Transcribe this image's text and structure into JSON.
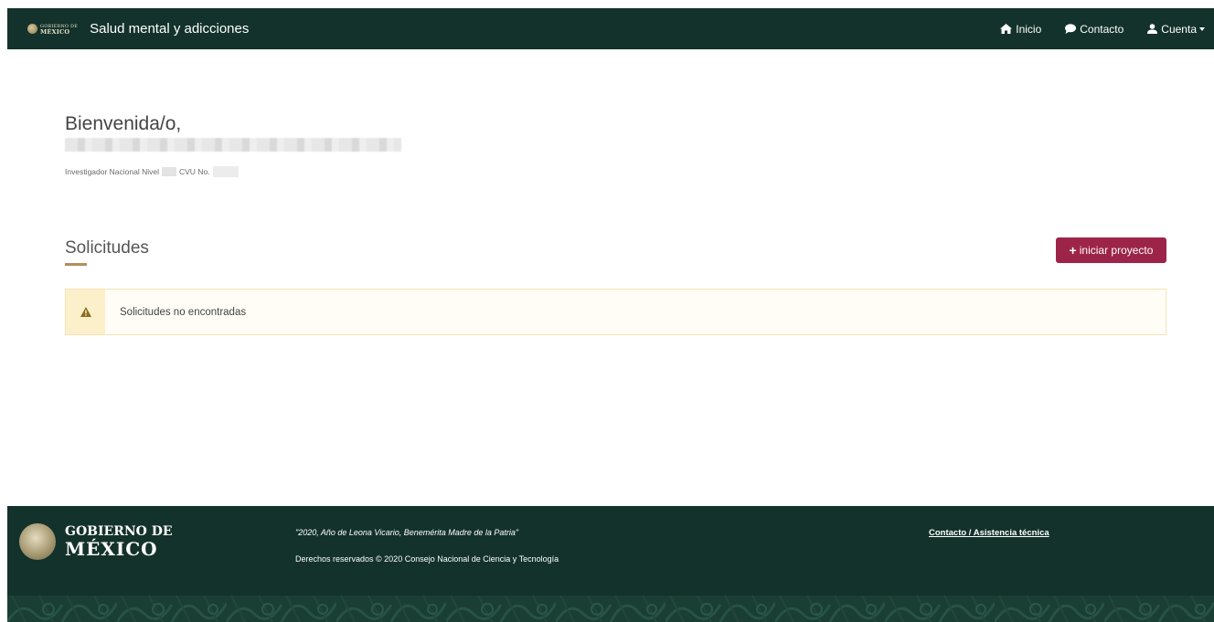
{
  "header": {
    "brand_line1": "GOBIERNO DE",
    "brand_line2": "MÉXICO",
    "title": "Salud mental y adicciones",
    "nav": {
      "home": "Inicio",
      "contact": "Contacto",
      "account": "Cuenta"
    }
  },
  "welcome": {
    "greeting": "Bienvenida/o,",
    "level_label": "Investigador Nacional Nivel",
    "cvu_label": "CVU No."
  },
  "requests": {
    "title": "Solicitudes",
    "start_button": "iniciar proyecto",
    "empty_message": "Solicitudes no encontradas"
  },
  "footer": {
    "logo_line1": "GOBIERNO DE",
    "logo_line2": "MÉXICO",
    "quote": "\"2020, Año de Leona Vicario, Benemérita Madre de la Patria\"",
    "rights": "Derechos reservados © 2020 Consejo Nacional de Ciencia y Tecnología",
    "contact_link": "Contacto / Asistencia técnica"
  },
  "colors": {
    "primary_dark": "#13322b",
    "accent": "#9d2449",
    "gold": "#b38e5d",
    "alert_bg": "#fcf0cb"
  }
}
